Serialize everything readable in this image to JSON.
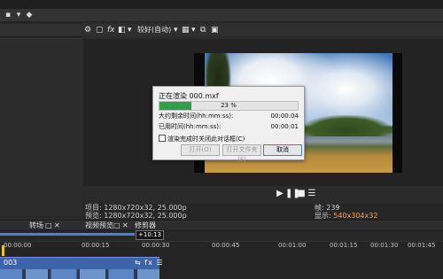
{
  "window": {
    "title": ""
  },
  "preview_toolbar": {
    "quality_label": "较好(自动)"
  },
  "render_dialog": {
    "title": "正在渲染 000.mxf",
    "progress": {
      "percent": 23,
      "label": "23 %"
    },
    "remaining_label": "大约剩余时间(hh:mm:ss):",
    "remaining_value": "00:00:04",
    "elapsed_label": "已用时间(hh:mm:ss):",
    "elapsed_value": "00:00:01",
    "close_on_complete_label": "渲染完成时关闭此对话框(C)",
    "close_on_complete_checked": false,
    "buttons": {
      "open": "打开(O)",
      "open_folder": "打开文件夹(F)",
      "cancel": "取消"
    }
  },
  "preview_info": {
    "project_line": "项目: 1280x720x32, 25.000p",
    "preview_line": "预览: 1280x720x32, 25.000p",
    "frame_line": "帧:     239",
    "display_line_label": "显示:",
    "display_line_value": "540x304x32"
  },
  "bottom_tabs": {
    "transitions": "转场",
    "video_preview": "视频预览",
    "trimmer": "修剪器"
  },
  "timeline": {
    "timecode": "+10:13",
    "ruler_labels": [
      "00:00:00",
      "00:00:15",
      "00:00:30",
      "00:00:45",
      "00:01:00",
      "00:01:15",
      "00:01:30",
      "00:01:45"
    ],
    "track_name": "003",
    "track_icons": "⇆ fx ☰"
  },
  "colors": {
    "progress": "#2ea043",
    "accent": "#4e7fd6",
    "track": "#3d63a8",
    "display_highlight": "#f0a35a"
  }
}
